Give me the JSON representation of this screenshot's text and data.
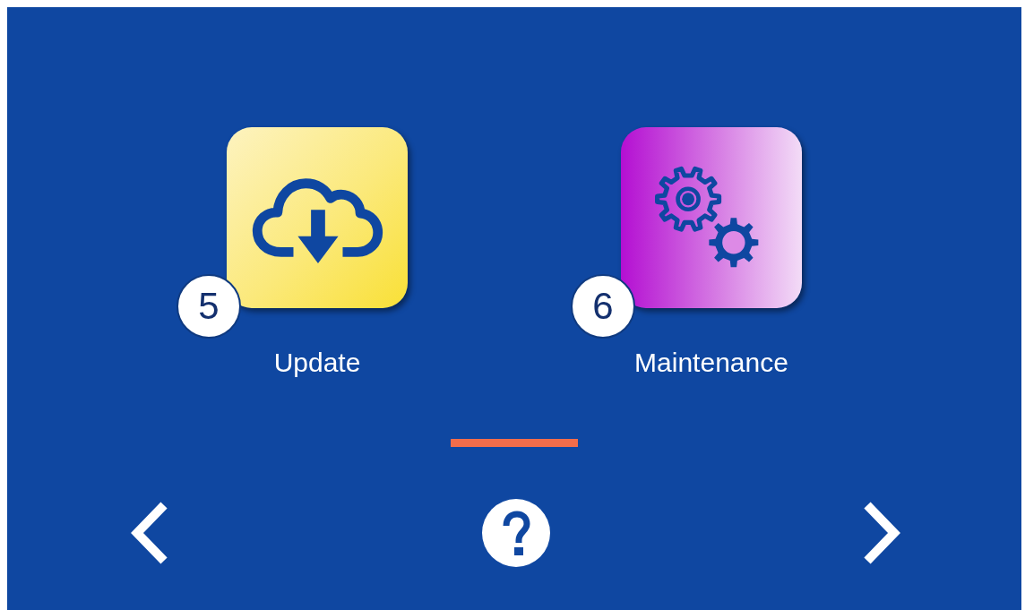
{
  "tiles": [
    {
      "kind": "update",
      "badge": "5",
      "label": "Update"
    },
    {
      "kind": "maintenance",
      "badge": "6",
      "label": "Maintenance"
    }
  ]
}
